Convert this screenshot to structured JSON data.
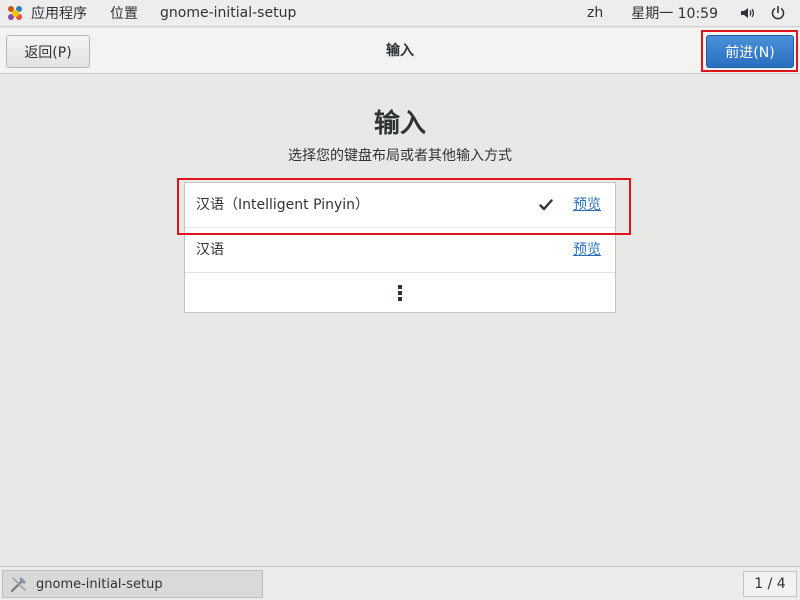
{
  "top_panel": {
    "apps_label": "应用程序",
    "places_label": "位置",
    "window_label": "gnome-initial-setup",
    "language": "zh",
    "clock": "星期一 10:59"
  },
  "header": {
    "back_label": "返回(P)",
    "title": "输入",
    "next_label": "前进(N)"
  },
  "main": {
    "title": "输入",
    "subtitle": "选择您的键盘布局或者其他输入方式",
    "inputs": [
      {
        "label": "汉语（Intelligent Pinyin）",
        "selected": true,
        "preview": "预览"
      },
      {
        "label": "汉语",
        "selected": false,
        "preview": "预览"
      }
    ]
  },
  "taskbar": {
    "task_label": "gnome-initial-setup",
    "workspace": "1 / 4"
  },
  "colors": {
    "accent": "#2a6fbf",
    "highlight": "#e0141e"
  }
}
